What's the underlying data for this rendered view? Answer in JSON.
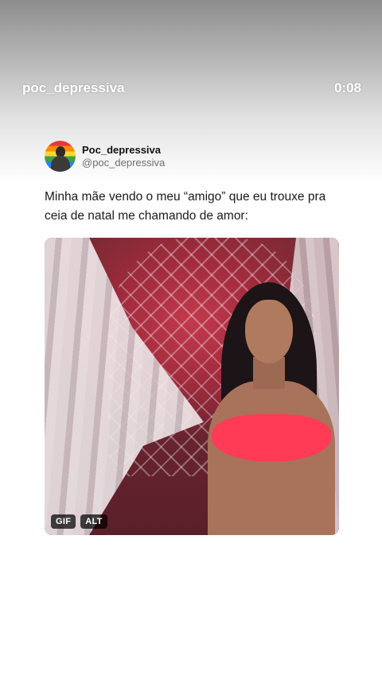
{
  "story": {
    "username": "poc_depressiva",
    "time": "0:08"
  },
  "tweet": {
    "display_name": "Poc_depressiva",
    "handle": "@poc_depressiva",
    "text": "Minha mãe vendo o meu “amigo” que eu trouxe pra ceia de natal me chamando de amor:",
    "media": {
      "badges": [
        "GIF",
        "ALT"
      ]
    }
  }
}
